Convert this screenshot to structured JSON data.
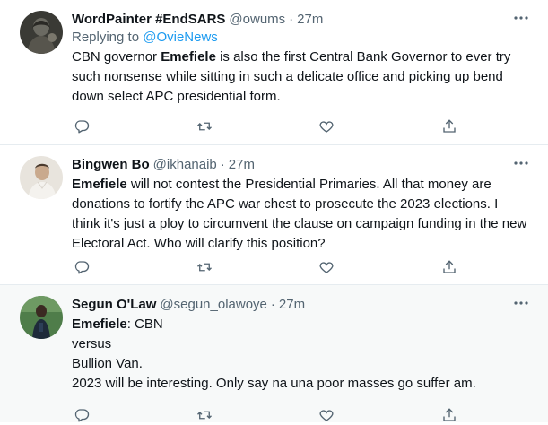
{
  "tweets": [
    {
      "name": "WordPainter #EndSARS",
      "handle": "@owums",
      "separator": "·",
      "time": "27m",
      "replying_prefix": "Replying to ",
      "replying_to": "@OvieNews",
      "text_before": "CBN governor ",
      "text_bold": "Emefiele",
      "text_after": " is also the first Central Bank Governor to ever try such nonsense while sitting in such a delicate office and picking up bend down select APC presidential form."
    },
    {
      "name": "Bingwen Bo",
      "handle": "@ikhanaib",
      "separator": "·",
      "time": "27m",
      "text_bold": "Emefiele",
      "text_after": " will not contest the Presidential Primaries.  All that money are donations to fortify the APC war chest to prosecute the 2023 elections. I think it's just a ploy to circumvent the clause on campaign funding in the new Electoral Act. Who will clarify this position?"
    },
    {
      "name": "Segun O'Law",
      "handle": "@segun_olawoye",
      "separator": "·",
      "time": "27m",
      "text_bold": "Emefiele",
      "text_line1_after": ": CBN",
      "lines": [
        "versus",
        "Bullion Van.",
        "2023 will be interesting. Only say na una poor masses go suffer am."
      ]
    }
  ],
  "colors": {
    "secondary_text": "#536471",
    "accent": "#1d9bf0",
    "divider": "#e6ecf0",
    "highlight_bg": "#f7f9f9"
  },
  "icons": {
    "more": "more-dots-icon",
    "reply": "reply-bubble-icon",
    "retweet": "retweet-arrows-icon",
    "like": "heart-icon",
    "share": "share-upload-icon"
  }
}
